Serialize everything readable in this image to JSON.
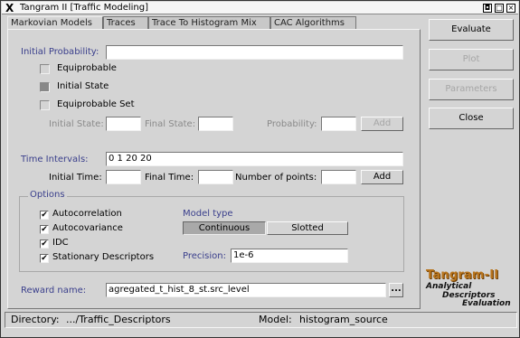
{
  "window": {
    "title": "Tangram II [Traffic Modeling]",
    "controls": [
      "◘",
      "□",
      "×"
    ]
  },
  "tabs": [
    {
      "label": "Markovian Models",
      "active": true
    },
    {
      "label": "Traces",
      "active": false
    },
    {
      "label": "Trace To Histogram Mix",
      "active": false
    },
    {
      "label": "CAC Algorithms",
      "active": false
    }
  ],
  "initial_probability": {
    "label": "Initial Probability:",
    "value": "",
    "options": [
      {
        "label": "Equiprobable",
        "selected": false
      },
      {
        "label": "Initial State",
        "selected": true
      },
      {
        "label": "Equiprobable Set",
        "selected": false
      }
    ],
    "initial_state_label": "Initial State:",
    "final_state_label": "Final State:",
    "probability_label": "Probability:",
    "add_label": "Add"
  },
  "time_intervals": {
    "label": "Time Intervals:",
    "value": "0 1 20 20",
    "initial_time_label": "Initial Time:",
    "final_time_label": "Final Time:",
    "points_label": "Number of points:",
    "add_label": "Add"
  },
  "options": {
    "legend": "Options",
    "checks": [
      {
        "label": "Autocorrelation",
        "checked": true
      },
      {
        "label": "Autocovariance",
        "checked": true
      },
      {
        "label": "IDC",
        "checked": true
      },
      {
        "label": "Stationary Descriptors",
        "checked": true
      }
    ],
    "model_type_label": "Model type",
    "model_type_options": [
      "Continuous",
      "Slotted"
    ],
    "model_type_selected": "Continuous",
    "precision_label": "Precision:",
    "precision_value": "1e-6"
  },
  "reward": {
    "label": "Reward name:",
    "value": "agregated_t_hist_8_st.src_level",
    "browse_label": "..."
  },
  "side_buttons": {
    "evaluate": "Evaluate",
    "plot": "Plot",
    "parameters": "Parameters",
    "close": "Close"
  },
  "logo": {
    "title": "Tangram-II",
    "line1": "Analytical",
    "line2": "Descriptors",
    "line3": "Evaluation"
  },
  "status": {
    "directory_label": "Directory:",
    "directory_value": ".../Traffic_Descriptors",
    "model_label": "Model:",
    "model_value": "histogram_source"
  },
  "colors": {
    "label_blue": "#3a3f8c",
    "logo_orange": "#b8741c",
    "background": "#d4d4d4"
  }
}
